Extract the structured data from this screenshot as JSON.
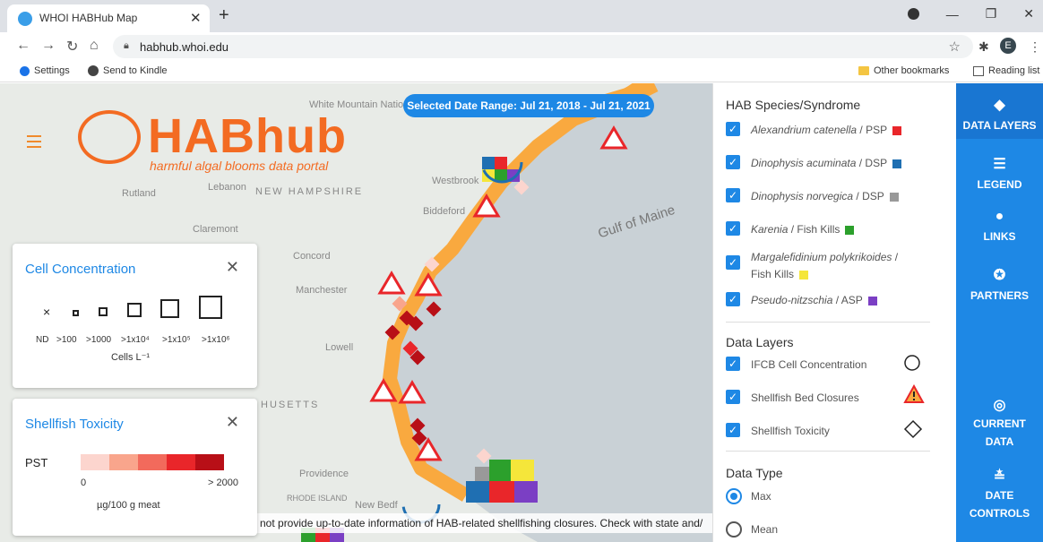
{
  "browser": {
    "tab_title": "WHOI HABHub Map",
    "url": "habhub.whoi.edu",
    "avatar_letter": "E",
    "bookmarks": [
      "Settings",
      "Send to Kindle"
    ],
    "other_bookmarks": "Other bookmarks",
    "reading_list": "Reading list"
  },
  "map": {
    "labels": [
      "White Mountain National Forest",
      "NEW HAMPSHIRE",
      "Rutland",
      "Lebanon",
      "Claremont",
      "Concord",
      "Manchester",
      "Lowell",
      "HUSETTS",
      "Providence",
      "RHODE ISLAND",
      "New Bedf",
      "Westbrook",
      "Biddeford",
      "Gulf of Maine"
    ],
    "logo_name": "HABhub",
    "logo_tag": "harmful algal blooms data portal",
    "date_range": "Selected Date Range: Jul 21, 2018 - Jul 21, 2021",
    "disclaimer": "not provide up-to-date information of HAB-related shellfishing closures. Check with state and/"
  },
  "cell_panel": {
    "title": "Cell Concentration",
    "nd": "×",
    "labels": [
      "ND",
      ">100",
      ">1000",
      ">1x10⁴",
      ">1x10⁵",
      ">1x10⁶"
    ],
    "unit": "Cells L⁻¹"
  },
  "tox_panel": {
    "title": "Shellfish Toxicity",
    "pst": "PST",
    "min": "0",
    "max": "> 2000",
    "unit": "µg/100 g meat",
    "scale_colors": [
      "#fcd5ce",
      "#f9a58c",
      "#f26a5c",
      "#e9262a",
      "#b80f17"
    ]
  },
  "side": {
    "species_title": "HAB Species/Syndrome",
    "species": [
      {
        "italic": "Alexandrium catenella",
        "rest": " / PSP",
        "color": "#e9262a"
      },
      {
        "italic": "Dinophysis acuminata",
        "rest": " / DSP",
        "color": "#1f6fb2"
      },
      {
        "italic": "Dinophysis norvegica",
        "rest": " / DSP",
        "color": "#999999"
      },
      {
        "italic": "Karenia",
        "rest": " / Fish Kills",
        "color": "#2ca02c"
      },
      {
        "italic": "Margalefidinium polykrikoides",
        "rest": " /",
        "line2": "Fish Kills",
        "color": "#f5e63a"
      },
      {
        "italic": "Pseudo-nitzschia",
        "rest": " / ASP",
        "color": "#7b3fc4"
      }
    ],
    "layers_title": "Data Layers",
    "layers": [
      "IFCB Cell Concentration",
      "Shellfish Bed Closures",
      "Shellfish Toxicity"
    ],
    "type_title": "Data Type",
    "types": [
      "Max",
      "Mean"
    ]
  },
  "nav": {
    "data_layers": "DATA LAYERS",
    "legend": "LEGEND",
    "links": "LINKS",
    "partners": "PARTNERS",
    "current_1": "CURRENT",
    "current_2": "DATA",
    "date_1": "DATE",
    "date_2": "CONTROLS"
  }
}
